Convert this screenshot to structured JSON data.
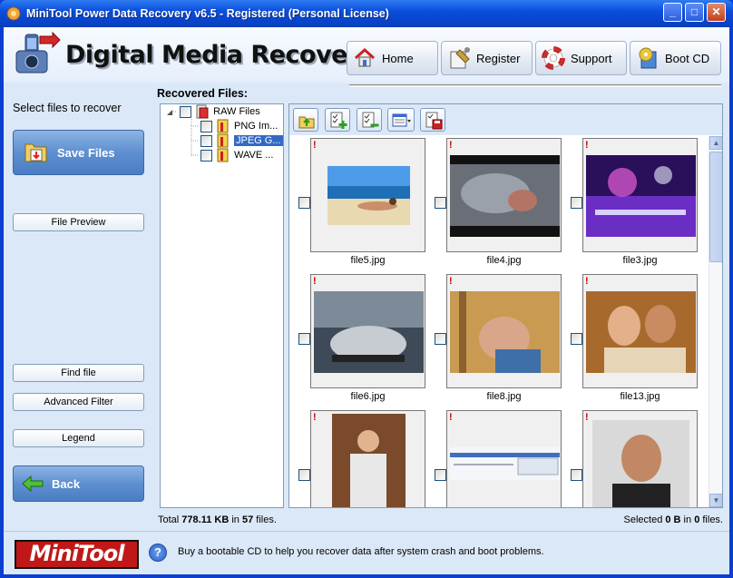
{
  "window": {
    "title": "MiniTool Power Data Recovery v6.5 - Registered (Personal License)",
    "minimize_glyph": "_",
    "maximize_glyph": "□",
    "close_glyph": "✕"
  },
  "header": {
    "product_title": "Digital Media Recovery",
    "nav": [
      {
        "label": "Home",
        "icon": "home-icon"
      },
      {
        "label": "Register",
        "icon": "register-icon"
      },
      {
        "label": "Support",
        "icon": "lifebuoy-icon"
      },
      {
        "label": "Boot CD",
        "icon": "boot-cd-icon"
      }
    ]
  },
  "sidebar": {
    "title": "Select files to recover",
    "save_files": "Save Files",
    "file_preview": "File Preview",
    "find_file": "Find file",
    "advanced_filter": "Advanced Filter",
    "legend": "Legend",
    "back": "Back"
  },
  "main": {
    "recovered_label": "Recovered Files:",
    "tree": [
      {
        "label": "RAW Files",
        "selected": false
      },
      {
        "label": "PNG Im...",
        "selected": false
      },
      {
        "label": "JPEG G...",
        "selected": true
      },
      {
        "label": "WAVE ...",
        "selected": false
      }
    ],
    "thumbnails": [
      {
        "name": "file5.jpg",
        "flag": "!"
      },
      {
        "name": "file4.jpg",
        "flag": "!"
      },
      {
        "name": "file3.jpg",
        "flag": "!"
      },
      {
        "name": "file6.jpg",
        "flag": "!"
      },
      {
        "name": "file8.jpg",
        "flag": "!"
      },
      {
        "name": "file13.jpg",
        "flag": "!"
      },
      {
        "name": "",
        "flag": "!"
      },
      {
        "name": "",
        "flag": "!"
      },
      {
        "name": "",
        "flag": "!"
      }
    ]
  },
  "status": {
    "total_prefix": "Total ",
    "total_size": "778.11 KB",
    "total_mid": " in ",
    "total_count": "57",
    "total_suffix": " files.",
    "selected_prefix": "Selected ",
    "selected_size": "0 B",
    "selected_mid": " in ",
    "selected_count": "0",
    "selected_suffix": " files."
  },
  "footer": {
    "brand": "MiniTool",
    "help_glyph": "?",
    "message": "Buy a bootable CD to help you recover data after system crash and boot problems."
  }
}
